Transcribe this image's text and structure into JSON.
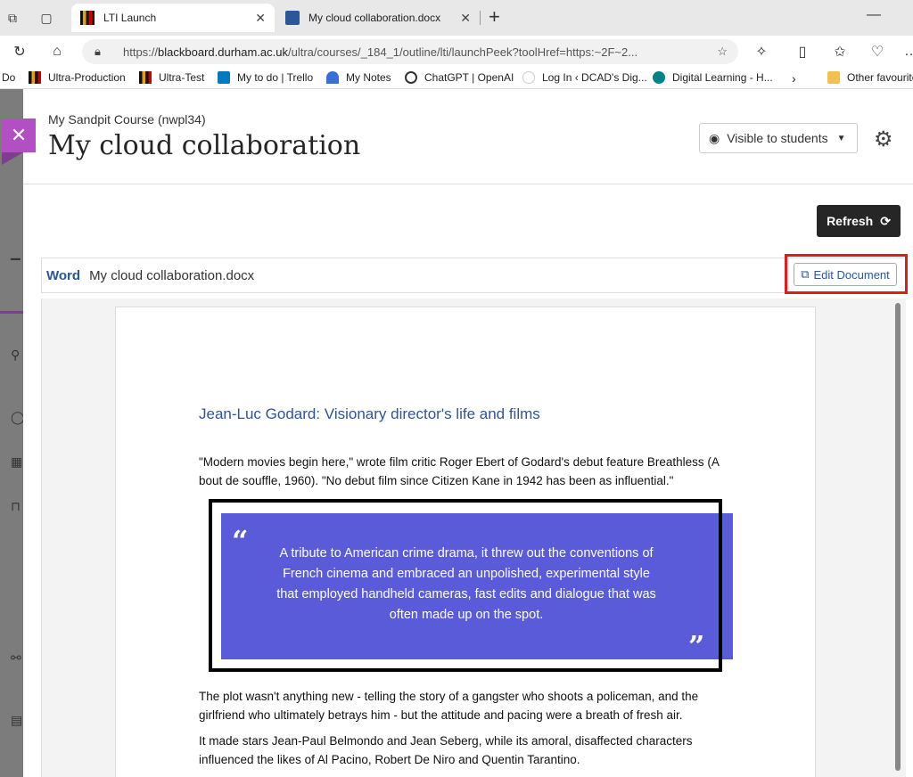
{
  "browser": {
    "tabs": [
      {
        "title": "LTI Launch",
        "active": true
      },
      {
        "title": "My cloud collaboration.docx",
        "active": false
      }
    ],
    "url": {
      "prefix": "https://",
      "host": "blackboard.durham.ac.uk",
      "path": "/ultra/courses/_184_1/outline/lti/launchPeek?toolHref=https:~2F~2..."
    },
    "bookmarks": [
      "Do",
      "Ultra-Production",
      "Ultra-Test",
      "My to do | Trello",
      "My Notes",
      "ChatGPT | OpenAI",
      "Log In ‹ DCAD's Dig...",
      "Digital Learning - H...",
      "Other favourites"
    ]
  },
  "header": {
    "course": "My Sandpit Course (nwpl34)",
    "title": "My cloud collaboration",
    "visibility": "Visible to students"
  },
  "toolbar": {
    "refresh": "Refresh"
  },
  "word": {
    "label": "Word",
    "filename": "My cloud collaboration.docx",
    "edit": "Edit Document"
  },
  "document": {
    "heading": "Jean-Luc Godard: Visionary director's life and films",
    "intro": "\"Modern movies begin here,\" wrote film critic Roger Ebert of Godard's debut feature Breathless (A bout de souffle, 1960). \"No debut film since Citizen Kane in 1942 has been as influential.\"",
    "quote": "A tribute to American crime drama, it threw out the conventions of French cinema and embraced an unpolished, experimental style that employed handheld cameras, fast edits and dialogue that was often made up on the spot.",
    "para2": "The plot wasn't anything new - telling the story of a gangster who shoots a policeman, and the girlfriend who ultimately betrays him - but the attitude and pacing were a breath of fresh air.",
    "para3": "It made stars Jean-Paul Belmondo and Jean Seberg, while its amoral, disaffected characters influenced the likes of Al Pacino, Robert De Niro and Quentin Tarantino."
  },
  "colors": {
    "accent": "#b24fc2",
    "quote_bg": "#5a5bd8",
    "word_blue": "#2b579a",
    "highlight": "#e21b1b"
  }
}
